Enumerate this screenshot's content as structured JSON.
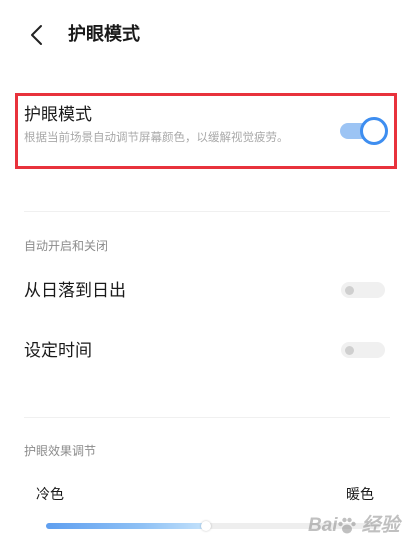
{
  "header": {
    "title": "护眼模式",
    "back_icon": "chevron-left-icon"
  },
  "eye_comfort": {
    "title": "护眼模式",
    "description": "根据当前场景自动调节屏幕颜色，以缓解视觉疲劳。",
    "enabled": true
  },
  "auto_schedule": {
    "section_label": "自动开启和关闭",
    "options": [
      {
        "label": "从日落到日出",
        "enabled": false
      },
      {
        "label": "设定时间",
        "enabled": false
      }
    ]
  },
  "effect": {
    "section_label": "护眼效果调节",
    "min_label": "冷色",
    "max_label": "暖色",
    "level": 0.48
  },
  "watermark": {
    "text": "Bai 经验"
  },
  "colors": {
    "accent": "#3e8ef0",
    "highlight_border": "#e8323c"
  }
}
